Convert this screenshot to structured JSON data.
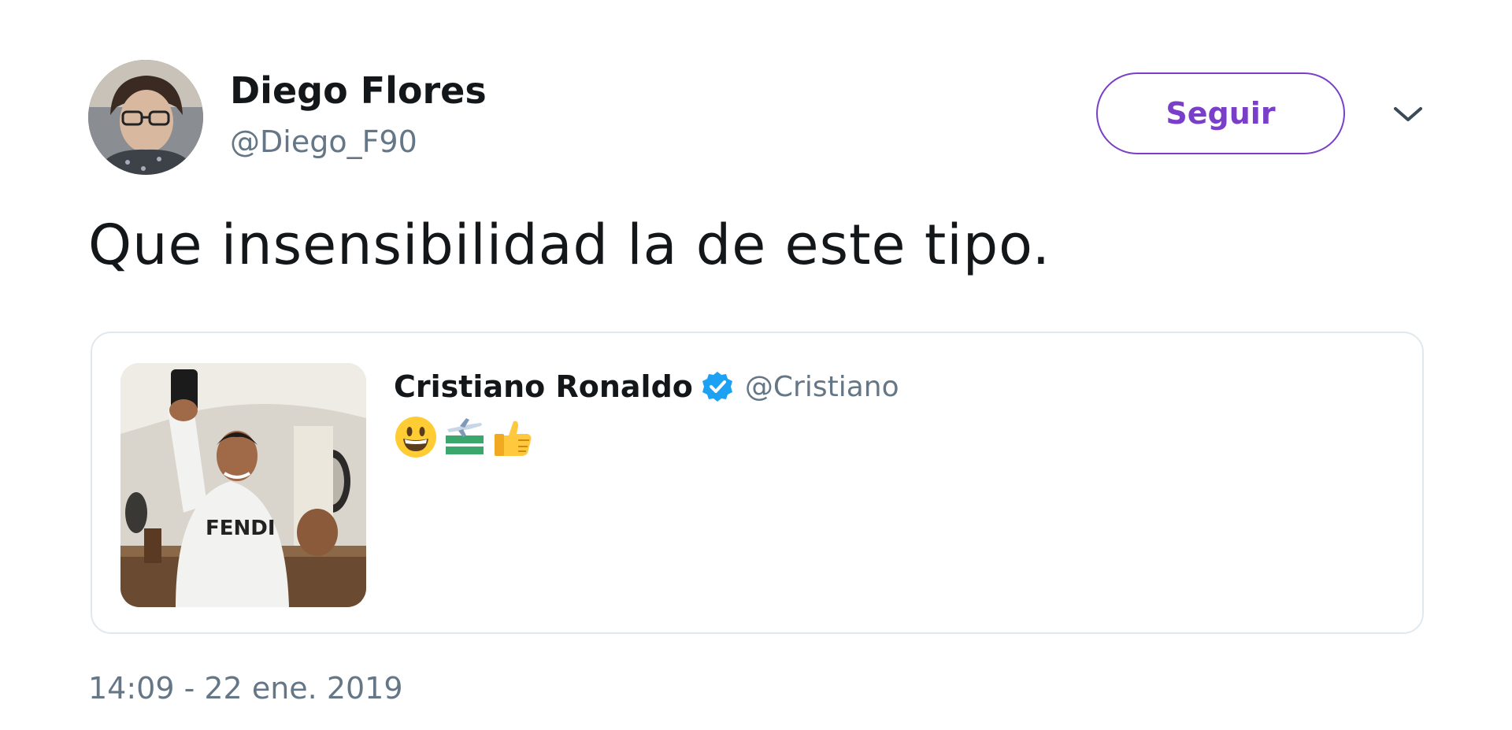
{
  "author": {
    "name": "Diego Flores",
    "handle": "@Diego_F90"
  },
  "follow_button": {
    "label": "Seguir",
    "color": "#7a3fc9"
  },
  "menu": {
    "icon": "chevron-down-icon"
  },
  "tweet": {
    "text": "Que insensibilidad la de este tipo.",
    "timestamp": "14:09 - 22 ene. 2019"
  },
  "quoted_tweet": {
    "author_name": "Cristiano Ronaldo",
    "verified": true,
    "verified_color": "#1da1f2",
    "handle": "@Cristiano",
    "emojis": [
      "grinning-face",
      "airplane-sticker",
      "thumbs-up"
    ]
  },
  "colors": {
    "text_primary": "#14171a",
    "text_secondary": "#657786",
    "border": "#e1e8ed"
  }
}
